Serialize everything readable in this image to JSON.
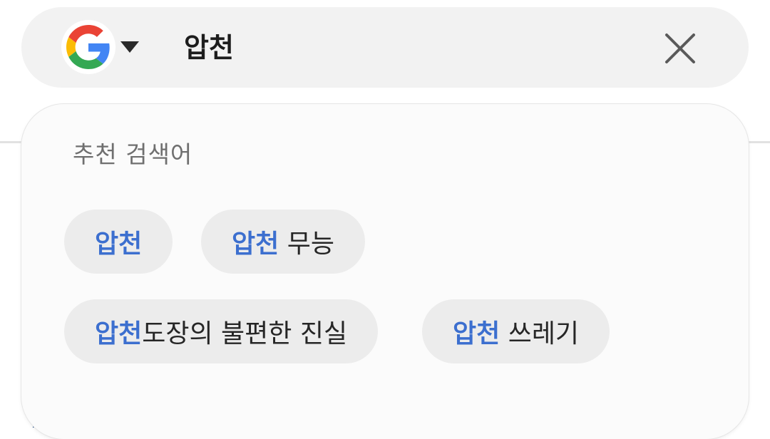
{
  "search": {
    "query": "압천",
    "engine_icon": "google-g-icon",
    "clear_icon": "close-icon"
  },
  "suggestions": {
    "heading": "추천 검색어",
    "items": [
      {
        "highlight": "압천",
        "rest": ""
      },
      {
        "highlight": "압천",
        "rest": " 무능"
      },
      {
        "highlight": "압천",
        "rest": "도장의 불편한 진실"
      },
      {
        "highlight": "압천",
        "rest": " 쓰레기"
      }
    ]
  },
  "colors": {
    "highlight": "#3c6fcf",
    "chip_background": "#ececec",
    "search_bar_background": "#f2f2f2"
  }
}
